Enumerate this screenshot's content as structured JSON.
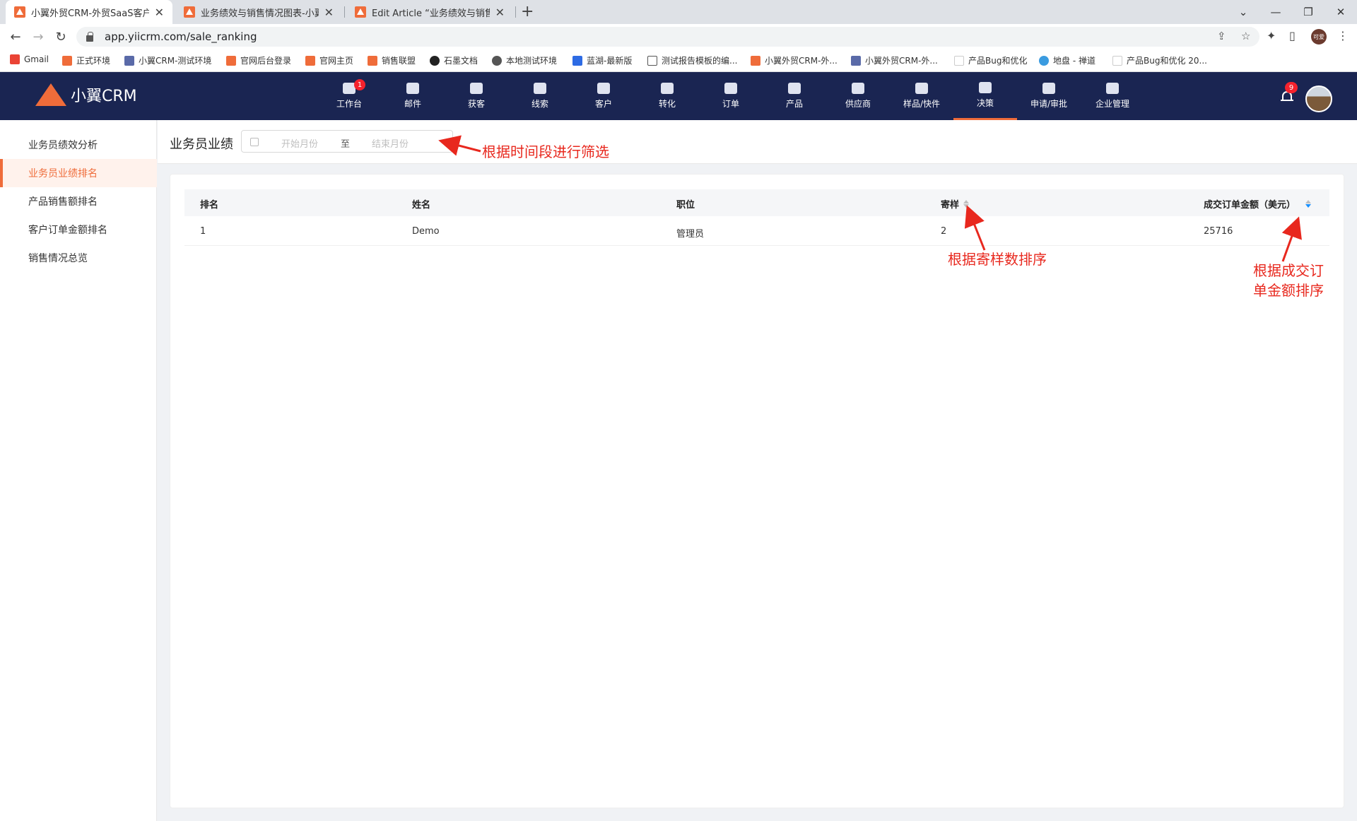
{
  "browser": {
    "tabs": [
      {
        "title": "小翼外贸CRM-外贸SaaS客户管理"
      },
      {
        "title": "业务绩效与销售情况图表-小翼外"
      },
      {
        "title": "Edit Article “业务绩效与销售情况"
      }
    ],
    "url": "app.yiicrm.com/sale_ranking",
    "profile_label": "可爱",
    "bookmarks": [
      {
        "label": "Gmail"
      },
      {
        "label": "正式环境"
      },
      {
        "label": "小翼CRM-测试环境"
      },
      {
        "label": "官网后台登录"
      },
      {
        "label": "官网主页"
      },
      {
        "label": "销售联盟"
      },
      {
        "label": "石墨文档"
      },
      {
        "label": "本地测试环境"
      },
      {
        "label": "蓝湖-最新版"
      },
      {
        "label": "测试报告模板的编..."
      },
      {
        "label": "小翼外贸CRM-外..."
      },
      {
        "label": "小翼外贸CRM-外..."
      },
      {
        "label": "产品Bug和优化"
      },
      {
        "label": "地盘 - 禅道"
      },
      {
        "label": "产品Bug和优化 20..."
      }
    ]
  },
  "app": {
    "logo_text": "小翼CRM",
    "nav": [
      {
        "label": "工作台",
        "badge": "1"
      },
      {
        "label": "邮件"
      },
      {
        "label": "获客"
      },
      {
        "label": "线索"
      },
      {
        "label": "客户"
      },
      {
        "label": "转化"
      },
      {
        "label": "订单"
      },
      {
        "label": "产品"
      },
      {
        "label": "供应商"
      },
      {
        "label": "样品/快件"
      },
      {
        "label": "决策",
        "active": true
      },
      {
        "label": "申请/审批"
      },
      {
        "label": "企业管理"
      }
    ],
    "notification_count": "9",
    "accent_color": "#ef6c3a",
    "header_color": "#1a2552"
  },
  "sidebar": {
    "items": [
      {
        "label": "业务员绩效分析"
      },
      {
        "label": "业务员业绩排名",
        "active": true
      },
      {
        "label": "产品销售额排名"
      },
      {
        "label": "客户订单金额排名"
      },
      {
        "label": "销售情况总览"
      }
    ]
  },
  "page": {
    "title": "业务员业绩",
    "range_start_placeholder": "开始月份",
    "range_separator": "至",
    "range_end_placeholder": "结束月份"
  },
  "table": {
    "columns": [
      "排名",
      "姓名",
      "职位",
      "寄样",
      "成交订单金额（美元）"
    ],
    "rows": [
      {
        "rank": "1",
        "name": "Demo",
        "position": "管理员",
        "samples": "2",
        "amount": "25716"
      }
    ]
  },
  "annotations": {
    "filter": "根据时间段进行筛选",
    "sample_sort": "根据寄样数排序",
    "amount_sort_line1": "根据成交订",
    "amount_sort_line2": "单金额排序"
  }
}
